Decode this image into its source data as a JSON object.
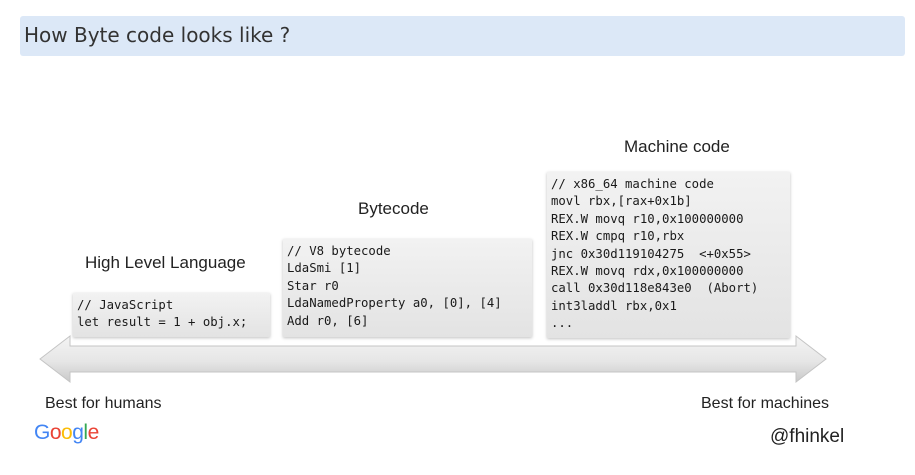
{
  "header": {
    "title": "How Byte code looks like ?"
  },
  "slide": {
    "columns": [
      {
        "title": "High Level Language",
        "code": [
          "// JavaScript",
          "let result = 1 + obj.x;"
        ]
      },
      {
        "title": "Bytecode",
        "code": [
          "// V8 bytecode",
          "LdaSmi [1]",
          "Star r0",
          "LdaNamedProperty a0, [0], [4]",
          "Add r0, [6]"
        ]
      },
      {
        "title": "Machine code",
        "code": [
          "// x86_64 machine code",
          "movl rbx,[rax+0x1b]",
          "REX.W movq r10,0x100000000",
          "REX.W cmpq r10,rbx",
          "jnc 0x30d119104275  <+0x55>",
          "REX.W movq rdx,0x100000000",
          "call 0x30d118e843e0  (Abort)",
          "int3laddl rbx,0x1",
          "..."
        ]
      }
    ],
    "arrow": {
      "left_label": "Best for humans",
      "right_label": "Best for machines"
    },
    "logo": {
      "text": "Google",
      "colors": [
        "#4285F4",
        "#EA4335",
        "#FBBC05",
        "#4285F4",
        "#34A853",
        "#EA4335"
      ]
    },
    "handle": "@fhinkel"
  }
}
